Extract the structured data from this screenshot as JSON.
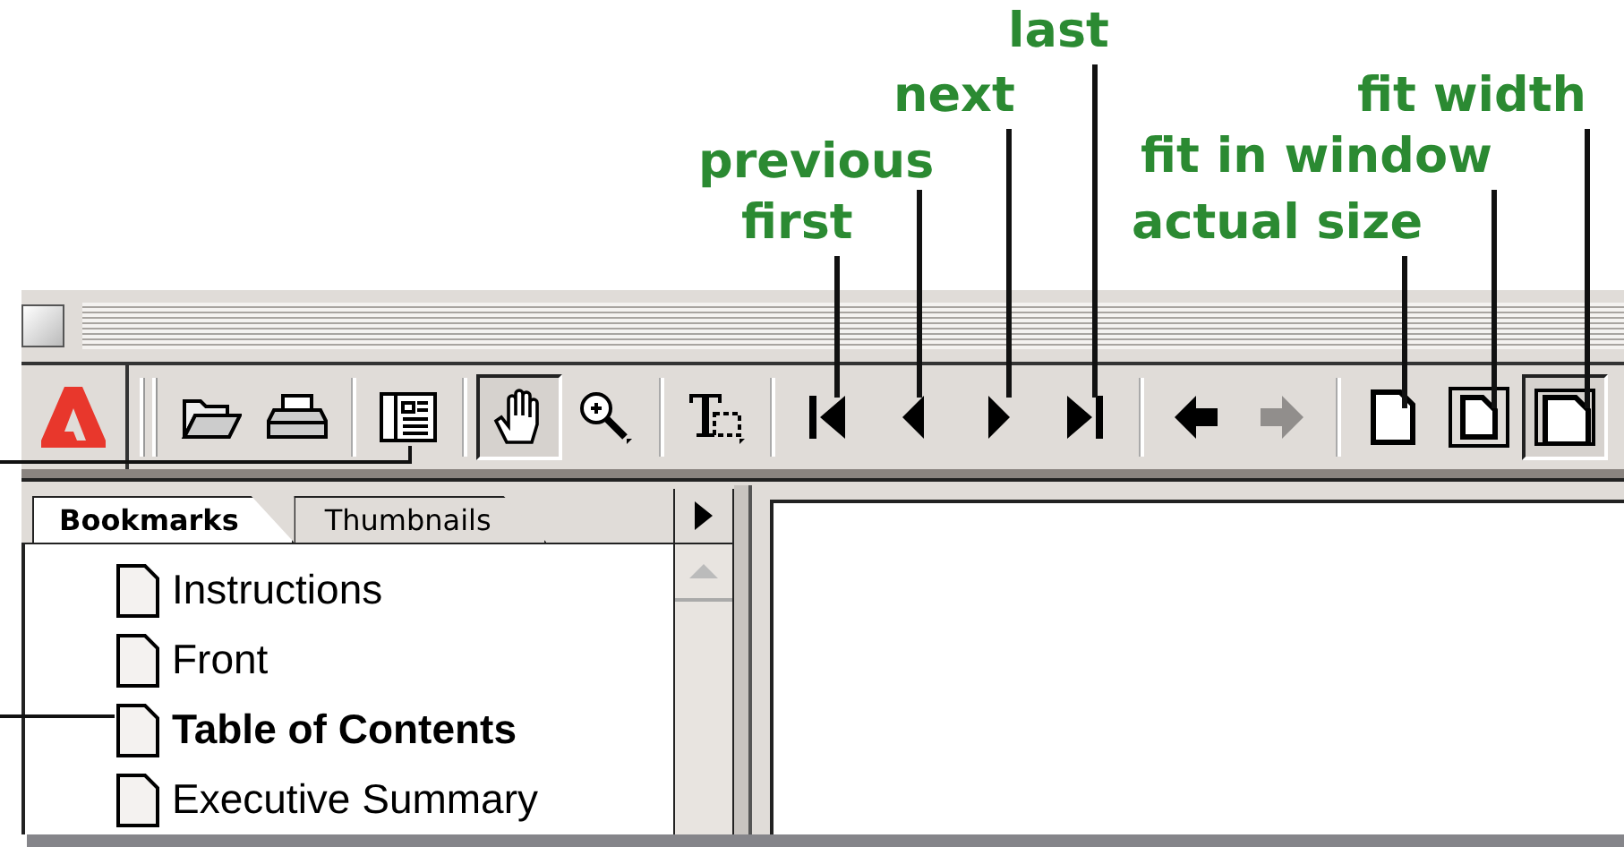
{
  "callouts": [
    {
      "label": "last"
    },
    {
      "label": "next"
    },
    {
      "label": "fit width"
    },
    {
      "label": "previous"
    },
    {
      "label": "fit in window"
    },
    {
      "label": "first"
    },
    {
      "label": "actual size"
    }
  ],
  "toolbar_groups": [
    {
      "buttons": [
        {
          "kind": "open",
          "pressed": false,
          "disabled": false
        },
        {
          "kind": "print",
          "pressed": false,
          "disabled": false
        }
      ]
    },
    {
      "buttons": [
        {
          "kind": "pane",
          "pressed": false,
          "disabled": false
        }
      ]
    },
    {
      "buttons": [
        {
          "kind": "hand",
          "pressed": true,
          "disabled": false
        },
        {
          "kind": "zoom",
          "pressed": false,
          "disabled": false
        }
      ]
    },
    {
      "buttons": [
        {
          "kind": "text-select",
          "pressed": false,
          "disabled": false
        }
      ]
    },
    {
      "buttons": [
        {
          "kind": "first",
          "pressed": false,
          "disabled": false
        },
        {
          "kind": "previous",
          "pressed": false,
          "disabled": false
        },
        {
          "kind": "next",
          "pressed": false,
          "disabled": false
        },
        {
          "kind": "last",
          "pressed": false,
          "disabled": false
        }
      ]
    },
    {
      "buttons": [
        {
          "kind": "back",
          "pressed": false,
          "disabled": false
        },
        {
          "kind": "forward",
          "pressed": false,
          "disabled": true
        }
      ]
    },
    {
      "buttons": [
        {
          "kind": "actual-size",
          "pressed": false,
          "disabled": false
        },
        {
          "kind": "fit-window",
          "pressed": false,
          "disabled": false
        },
        {
          "kind": "fit-width",
          "pressed": true,
          "disabled": false
        }
      ]
    }
  ],
  "tabs": [
    {
      "label": "Bookmarks",
      "selected": true
    },
    {
      "label": "Thumbnails",
      "selected": false
    }
  ],
  "bookmarks": [
    {
      "label": "Instructions",
      "selected": false
    },
    {
      "label": "Front",
      "selected": false
    },
    {
      "label": "Table of Contents",
      "selected": true
    },
    {
      "label": "Executive Summary",
      "selected": false
    }
  ]
}
